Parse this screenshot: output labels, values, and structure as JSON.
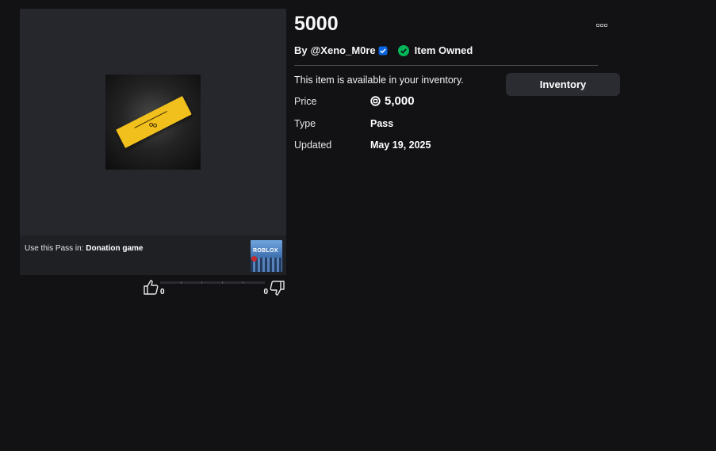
{
  "item": {
    "title": "5000",
    "by_prefix": "By",
    "creator": "@Xeno_M0re",
    "owned_label": "Item Owned",
    "availability": "This item is available in your inventory.",
    "inventory_button": "Inventory",
    "details": [
      {
        "label": "Price",
        "value": "5,000"
      },
      {
        "label": "Type",
        "value": "Pass"
      },
      {
        "label": "Updated",
        "value": "May 19, 2025"
      }
    ]
  },
  "thumbnail": {
    "use_prefix": "Use this Pass in:",
    "game_name": "Donation game",
    "game_thumb_logo": "ROBLOX"
  },
  "votes": {
    "up": "0",
    "down": "0"
  },
  "icons": [
    "verified-badge-icon",
    "check-circle-icon",
    "robux-icon",
    "more-options-icon",
    "thumbs-up-icon",
    "thumbs-down-icon"
  ],
  "colors": {
    "background": "#121215",
    "panel": "#25272c",
    "button": "#2a2c32",
    "owned_green": "#02b757",
    "verified_blue": "#0b67e1",
    "pass_yellow": "#f2c01d"
  }
}
